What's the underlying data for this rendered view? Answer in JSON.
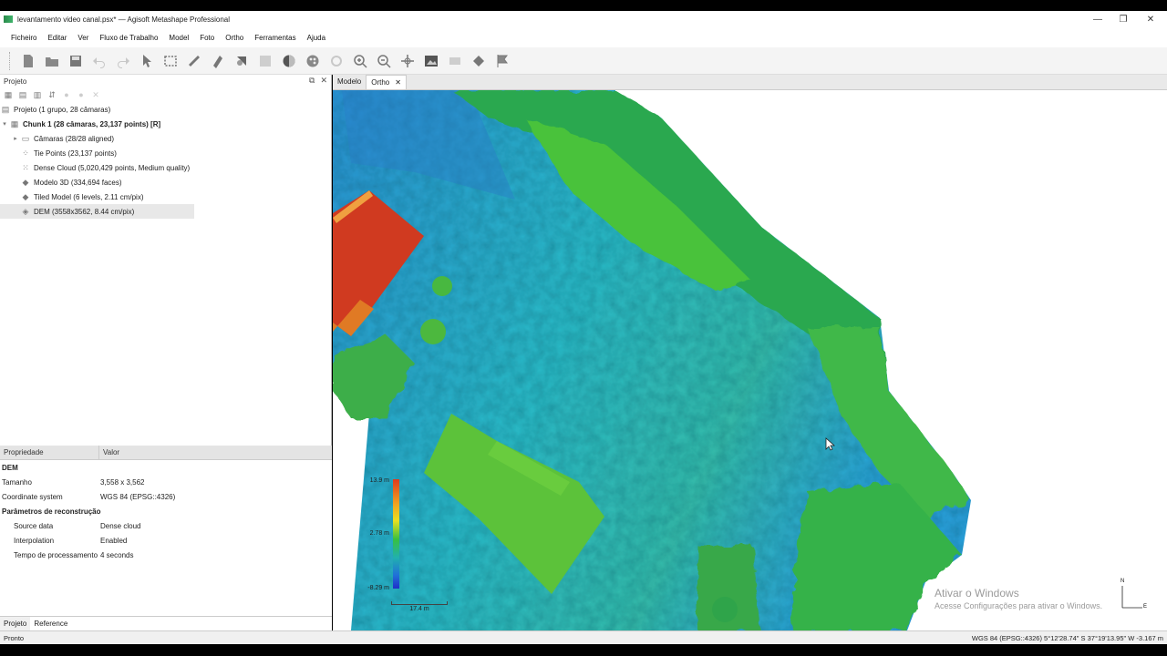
{
  "window": {
    "title": "levantamento video canal.psx* — Agisoft Metashape Professional",
    "controls": [
      "—",
      "❐",
      "✕"
    ]
  },
  "menu": [
    "Ficheiro",
    "Editar",
    "Ver",
    "Fluxo de Trabalho",
    "Model",
    "Foto",
    "Ortho",
    "Ferramentas",
    "Ajuda"
  ],
  "project_panel": {
    "title": "Projeto",
    "root": "Projeto (1 grupo, 28 câmaras)",
    "chunk": "Chunk 1 (28 câmaras, 23,137 points) [R]",
    "items": [
      {
        "label": "Câmaras (28/28 aligned)",
        "icon": "folder-icon"
      },
      {
        "label": "Tie Points (23,137 points)",
        "icon": "tie-points-icon"
      },
      {
        "label": "Dense Cloud (5,020,429 points, Medium quality)",
        "icon": "dense-cloud-icon"
      },
      {
        "label": "Modelo 3D (334,694 faces)",
        "icon": "model-icon"
      },
      {
        "label": "Tiled Model (6 levels, 2.11 cm/pix)",
        "icon": "tiled-model-icon"
      },
      {
        "label": "DEM (3558x3562, 8.44 cm/pix)",
        "icon": "dem-icon"
      }
    ]
  },
  "properties": {
    "col_property": "Propriedade",
    "col_value": "Valor",
    "section": "DEM",
    "rows": [
      {
        "k": "Tamanho",
        "v": "3,558 x 3,562"
      },
      {
        "k": "Coordinate system",
        "v": "WGS 84 (EPSG::4326)"
      }
    ],
    "subsection": "Parâmetros de reconstrução",
    "subrows": [
      {
        "k": "Source data",
        "v": "Dense cloud"
      },
      {
        "k": "Interpolation",
        "v": "Enabled"
      },
      {
        "k": "Tempo de processamento",
        "v": "4 seconds"
      }
    ]
  },
  "bottom_tabs": [
    "Projeto",
    "Reference"
  ],
  "view_tabs": {
    "model": "Modelo",
    "ortho": "Ortho"
  },
  "legend": {
    "max": "13.9 m",
    "mid": "2.78 m",
    "min": "-8.29 m"
  },
  "scale": {
    "label": "17.4 m"
  },
  "north": {
    "n": "N",
    "e": "E"
  },
  "watermark": {
    "line1": "Ativar o Windows",
    "line2": "Acesse Configurações para ativar o Windows."
  },
  "status": {
    "left": "Pronto",
    "right": "WGS 84 (EPSG::4326)   5°12'28.74\" S   37°19'13.95\" W   -3.167 m"
  },
  "colors": {
    "accent_green": "#3fb36b",
    "selection": "#e8e8e8"
  }
}
